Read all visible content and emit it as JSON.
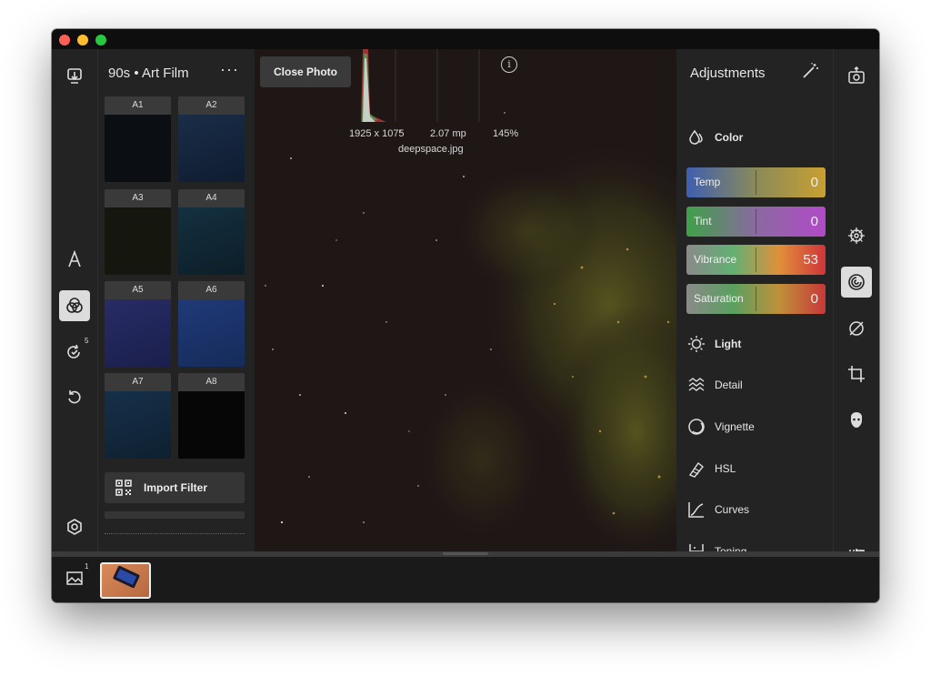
{
  "window": {
    "traffic_lights": [
      "close",
      "minimize",
      "zoom"
    ]
  },
  "left_rail": {
    "items": [
      {
        "icon": "import-icon"
      },
      {
        "icon": "text-icon"
      },
      {
        "icon": "filters-icon",
        "active": true
      },
      {
        "icon": "history-icon",
        "badge": "5"
      },
      {
        "icon": "revert-icon"
      },
      {
        "icon": "settings-hexagon-icon"
      }
    ]
  },
  "filter_panel": {
    "title": "90s • Art Film",
    "more_label": "···",
    "thumbs": [
      {
        "label": "A1",
        "tone": "#0b0f14"
      },
      {
        "label": "A2",
        "tone": "#13233a"
      },
      {
        "label": "A3",
        "tone": "#15170f"
      },
      {
        "label": "A4",
        "tone": "#0f2530"
      },
      {
        "label": "A5",
        "tone": "#1e2357"
      },
      {
        "label": "A6",
        "tone": "#1a3168"
      },
      {
        "label": "A7",
        "tone": "#12283a"
      },
      {
        "label": "A8",
        "tone": "#060606"
      }
    ],
    "import_label": "Import Filter"
  },
  "canvas": {
    "close_label": "Close Photo",
    "dimensions": "1925 x 1075",
    "megapixels": "2.07 mp",
    "zoom": "145%",
    "filename": "deepspace.jpg",
    "info_label": "i"
  },
  "adjustments": {
    "title": "Adjustments",
    "color_section": "Color",
    "sliders": [
      {
        "label": "Temp",
        "value": "0"
      },
      {
        "label": "Tint",
        "value": "0"
      },
      {
        "label": "Vibrance",
        "value": "53"
      },
      {
        "label": "Saturation",
        "value": "0"
      }
    ],
    "sections": [
      {
        "label": "Light",
        "icon": "sun-icon"
      },
      {
        "label": "Detail",
        "icon": "detail-icon"
      },
      {
        "label": "Vignette",
        "icon": "vignette-icon"
      },
      {
        "label": "HSL",
        "icon": "hsl-icon"
      },
      {
        "label": "Curves",
        "icon": "curves-icon"
      },
      {
        "label": "Toning",
        "icon": "toning-icon"
      }
    ]
  },
  "right_rail": {
    "items": [
      {
        "icon": "export-icon"
      },
      {
        "icon": "wheel-icon"
      },
      {
        "icon": "adjustments-icon",
        "active": true
      },
      {
        "icon": "heal-icon"
      },
      {
        "icon": "crop-icon"
      },
      {
        "icon": "face-icon"
      },
      {
        "icon": "compare-icon"
      }
    ]
  },
  "filmstrip": {
    "count_badge": "1"
  },
  "colors": {
    "temp_gradient": [
      "#3f5fb0",
      "#8a8a5a",
      "#c9a030"
    ],
    "tint_gradient": [
      "#3fa048",
      "#8a6aa0",
      "#b24ac8"
    ],
    "vibrance_gradient": [
      "#8a8a8a",
      "#62b072",
      "#e0903a",
      "#d0343a"
    ],
    "saturation_gradient": [
      "#8a8a8a",
      "#5aa060",
      "#c0903a",
      "#c83838"
    ]
  }
}
